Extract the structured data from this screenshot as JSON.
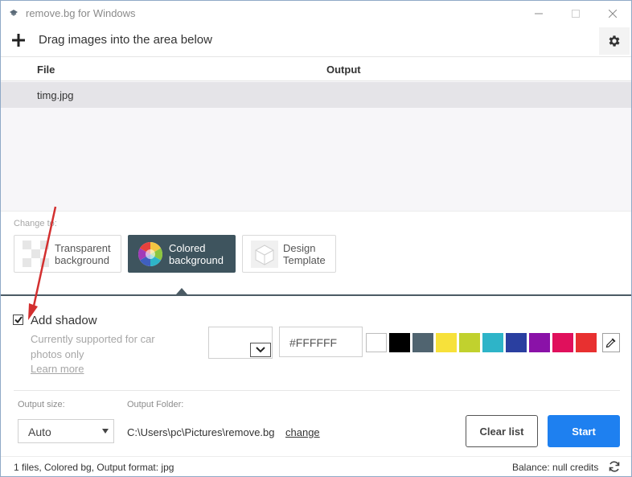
{
  "titlebar": {
    "title": "remove.bg for Windows",
    "min_icon": "minimize-icon",
    "max_icon": "maximize-icon",
    "close_icon": "close-icon"
  },
  "toolbar": {
    "add_icon": "plus-icon",
    "hint": "Drag images into the area below",
    "settings_icon": "gear-icon"
  },
  "file_list": {
    "columns": [
      "File",
      "Output"
    ],
    "rows": [
      {
        "file": "timg.jpg",
        "output": ""
      }
    ]
  },
  "change_to": {
    "label": "Change to:",
    "options": [
      {
        "line1": "Transparent",
        "line2": "background",
        "selected": false,
        "icon": "checkerboard-icon"
      },
      {
        "line1": "Colored",
        "line2": "background",
        "selected": true,
        "icon": "color-wheel-icon"
      },
      {
        "line1": "Design",
        "line2": "Template",
        "selected": false,
        "icon": "cube-icon"
      }
    ]
  },
  "shadow": {
    "checked": true,
    "label": "Add shadow",
    "description": "Currently supported for car photos only",
    "learn_more": "Learn more"
  },
  "color": {
    "hex_value": "#FFFFFF",
    "swatches": [
      "#ffffff",
      "#000000",
      "#506470",
      "#f7e13a",
      "#c1d12e",
      "#2eb4c8",
      "#2a3fa0",
      "#8a12a8",
      "#e0105c",
      "#e83030"
    ],
    "picker_icon": "eyedropper-icon"
  },
  "output": {
    "size_label": "Output size:",
    "size_value": "Auto",
    "folder_label": "Output Folder:",
    "folder_path": "C:\\Users\\pc\\Pictures\\remove.bg",
    "change_link": "change",
    "clear_label": "Clear list",
    "start_label": "Start"
  },
  "status": {
    "summary": "1 files, Colored bg, Output format: jpg",
    "balance": "Balance: null credits",
    "refresh_icon": "refresh-icon"
  },
  "colors": {
    "accent": "#1e80f0",
    "selected_option": "#3e545e",
    "annotation_arrow": "#d32f2f"
  }
}
